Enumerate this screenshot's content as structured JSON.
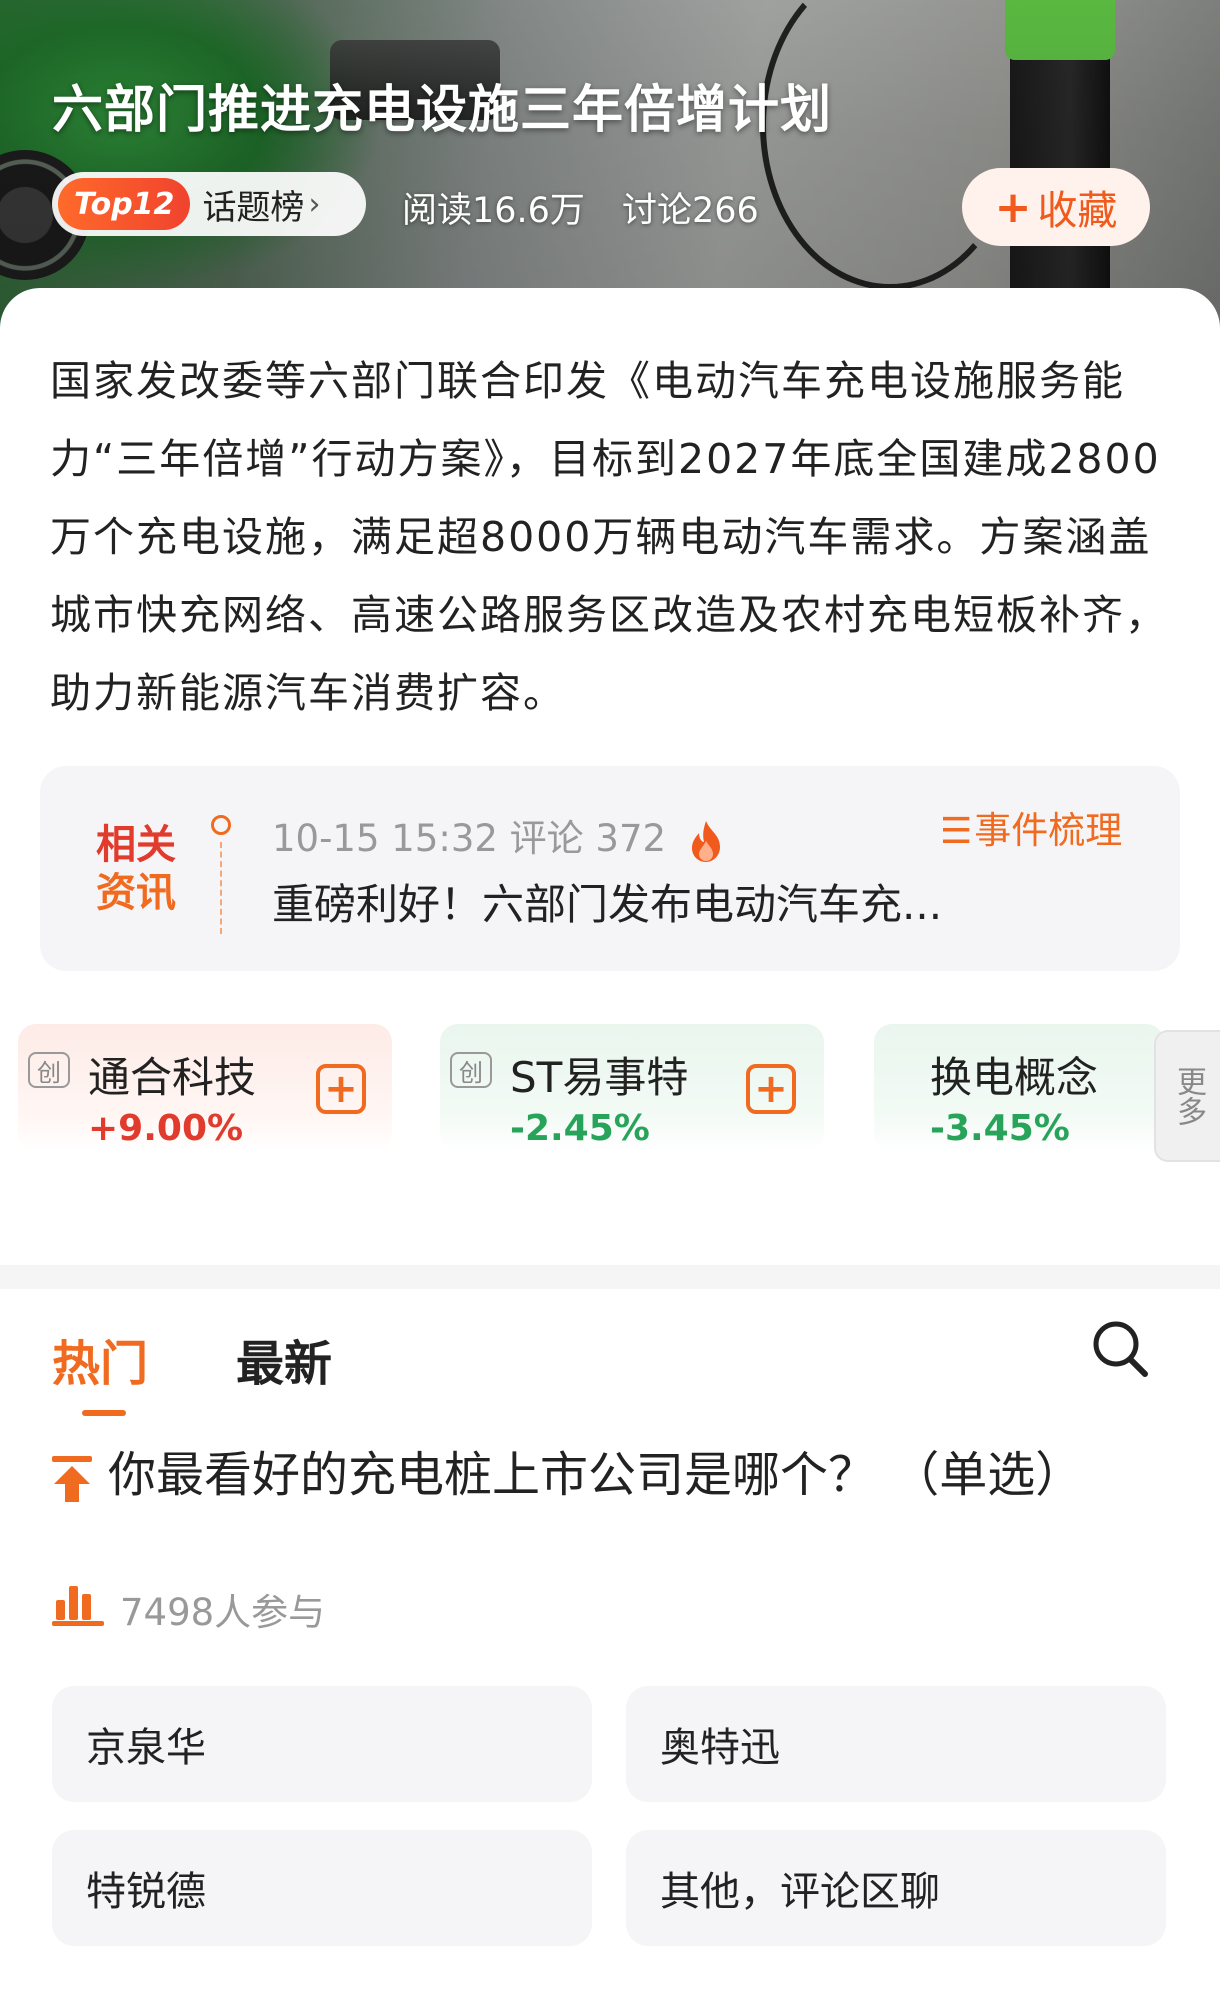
{
  "header": {
    "title": "六部门推进充电设施三年倍增计划",
    "rank_badge": "Top12",
    "rank_label": "话题榜",
    "reads": "阅读16.6万",
    "comments": "讨论266",
    "favorite_label": "收藏"
  },
  "summary": {
    "text": "国家发改委等六部门联合印发《电动汽车充电设施服务能力“三年倍增”行动方案》，目标到2027年底全国建成2800万个充电设施，满足超8000万辆电动汽车需求。方案涵盖城市快充网络、高速公路服务区改造及农村充电短板补齐，助力新能源汽车消费扩容。"
  },
  "related_news": {
    "tag_line1": "相关",
    "tag_line2": "资讯",
    "meta": "10-15 15:32 评论 372",
    "headline": "重磅利好！六部门发布电动汽车充...",
    "event_link": "事件梳理"
  },
  "stocks": [
    {
      "tag": "创",
      "name": "通合科技",
      "change": "+9.00%",
      "direction": "up"
    },
    {
      "tag": "创",
      "name": "ST易事特",
      "change": "-2.45%",
      "direction": "down"
    },
    {
      "tag": "",
      "name": "换电概念",
      "change": "-3.45%",
      "direction": "down"
    }
  ],
  "more_label": "更多",
  "tabs": {
    "hot": "热门",
    "latest": "最新"
  },
  "poll": {
    "question": "你最看好的充电桩上市公司是哪个？  （单选）",
    "participants": "7498人参与",
    "options": [
      "京泉华",
      "奥特迅",
      "特锐德",
      "其他，评论区聊"
    ]
  },
  "colors": {
    "accent": "#f06a1f",
    "up": "#e03b2d",
    "down": "#28a35a"
  }
}
